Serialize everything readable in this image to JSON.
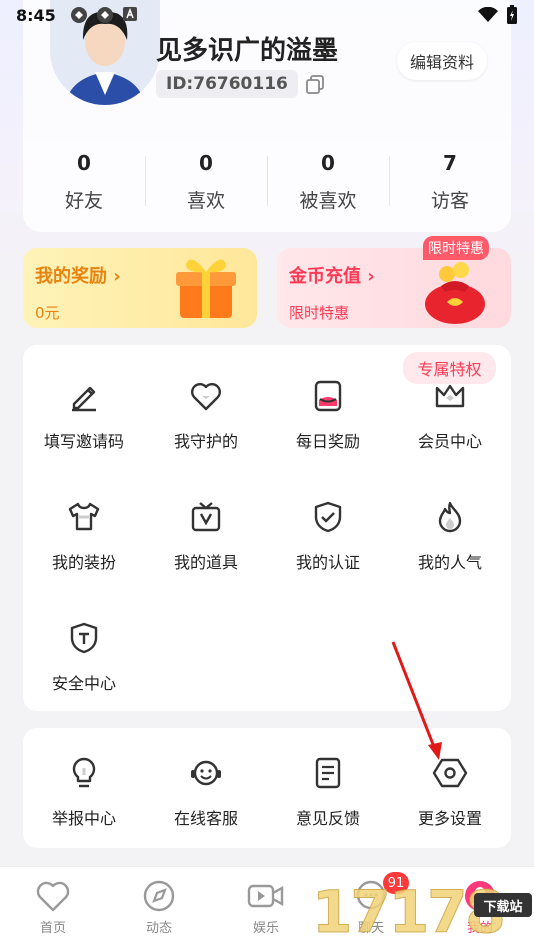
{
  "status_bar": {
    "time": "8:45"
  },
  "profile": {
    "nickname": "见多识广的溢墨",
    "user_id": "ID:76760116",
    "edit_label": "编辑资料",
    "stats": [
      {
        "value": "0",
        "label": "好友"
      },
      {
        "value": "0",
        "label": "喜欢"
      },
      {
        "value": "0",
        "label": "被喜欢"
      },
      {
        "value": "7",
        "label": "访客"
      }
    ]
  },
  "promos": {
    "reward": {
      "title": "我的奖励 ›",
      "subtitle": "0元"
    },
    "recharge": {
      "title": "金币充值 ›",
      "subtitle": "限时特惠",
      "tag": "限时特惠"
    }
  },
  "features": {
    "vip_tag": "专属特权",
    "items": [
      {
        "label": "填写邀请码",
        "icon": "pencil-icon"
      },
      {
        "label": "我守护的",
        "icon": "heart-icon"
      },
      {
        "label": "每日奖励",
        "icon": "daily-reward-icon"
      },
      {
        "label": "会员中心",
        "icon": "crown-icon"
      },
      {
        "label": "我的装扮",
        "icon": "tshirt-icon"
      },
      {
        "label": "我的道具",
        "icon": "prop-box-icon"
      },
      {
        "label": "我的认证",
        "icon": "verified-shield-icon"
      },
      {
        "label": "我的人气",
        "icon": "flame-icon"
      },
      {
        "label": "安全中心",
        "icon": "security-shield-icon"
      }
    ]
  },
  "services": {
    "items": [
      {
        "label": "举报中心",
        "icon": "lightbulb-icon"
      },
      {
        "label": "在线客服",
        "icon": "headset-smile-icon"
      },
      {
        "label": "意见反馈",
        "icon": "document-icon"
      },
      {
        "label": "更多设置",
        "icon": "hexagon-settings-icon"
      }
    ]
  },
  "tabbar": {
    "items": [
      {
        "label": "首页"
      },
      {
        "label": "动态"
      },
      {
        "label": "娱乐"
      },
      {
        "label": "聊天"
      },
      {
        "label": "我的"
      }
    ],
    "chat_badge": "91"
  },
  "watermark": {
    "text": "17178",
    "sub": "下载站"
  },
  "colors": {
    "accent": "#ff3a55",
    "reward": "#e8830f",
    "panel": "#ffffff"
  }
}
